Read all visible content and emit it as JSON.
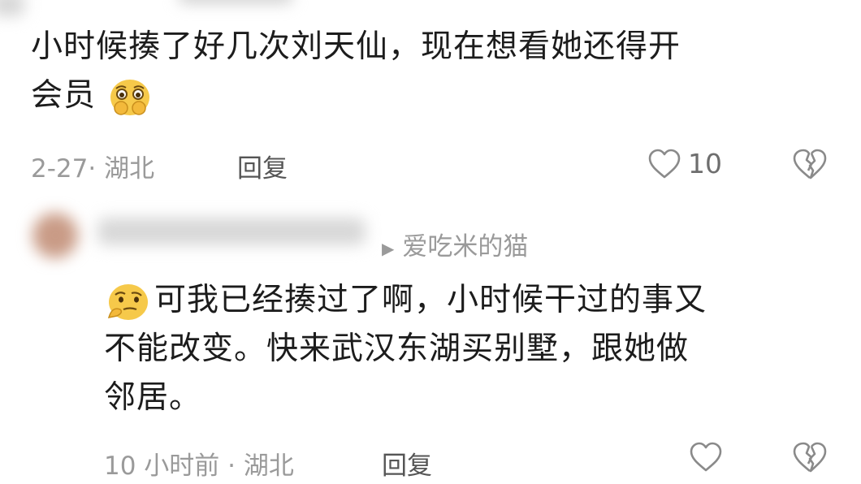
{
  "top_comment": {
    "text_line1": "小时候揍了好几次刘天仙，现在想看她还得开",
    "text_line2": "会员",
    "emoji": "crying-hands-emoji",
    "date": "2-27",
    "separator": "·",
    "location": "湖北",
    "reply_label": "回复",
    "like_count": "10"
  },
  "reply_comment": {
    "reply_to_arrow": "▶",
    "reply_to_name": "爱吃米的猫",
    "emoji": "thinking-face-emoji",
    "text_line1": "可我已经揍过了啊，小时候干过的事又",
    "text_line2": "不能改变。快来武汉东湖买别墅，跟她做",
    "text_line3": "邻居。",
    "time": "10 小时前",
    "separator": "·",
    "location": "湖北",
    "reply_label": "回复"
  },
  "colors": {
    "text": "#1c1c1c",
    "meta": "#9a9a9a",
    "icon": "#8a8a8a"
  }
}
